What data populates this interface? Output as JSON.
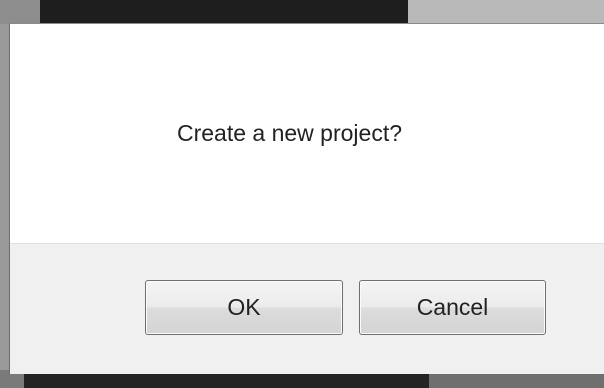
{
  "dialog": {
    "message": "Create a new project?",
    "ok_label": "OK",
    "cancel_label": "Cancel"
  }
}
